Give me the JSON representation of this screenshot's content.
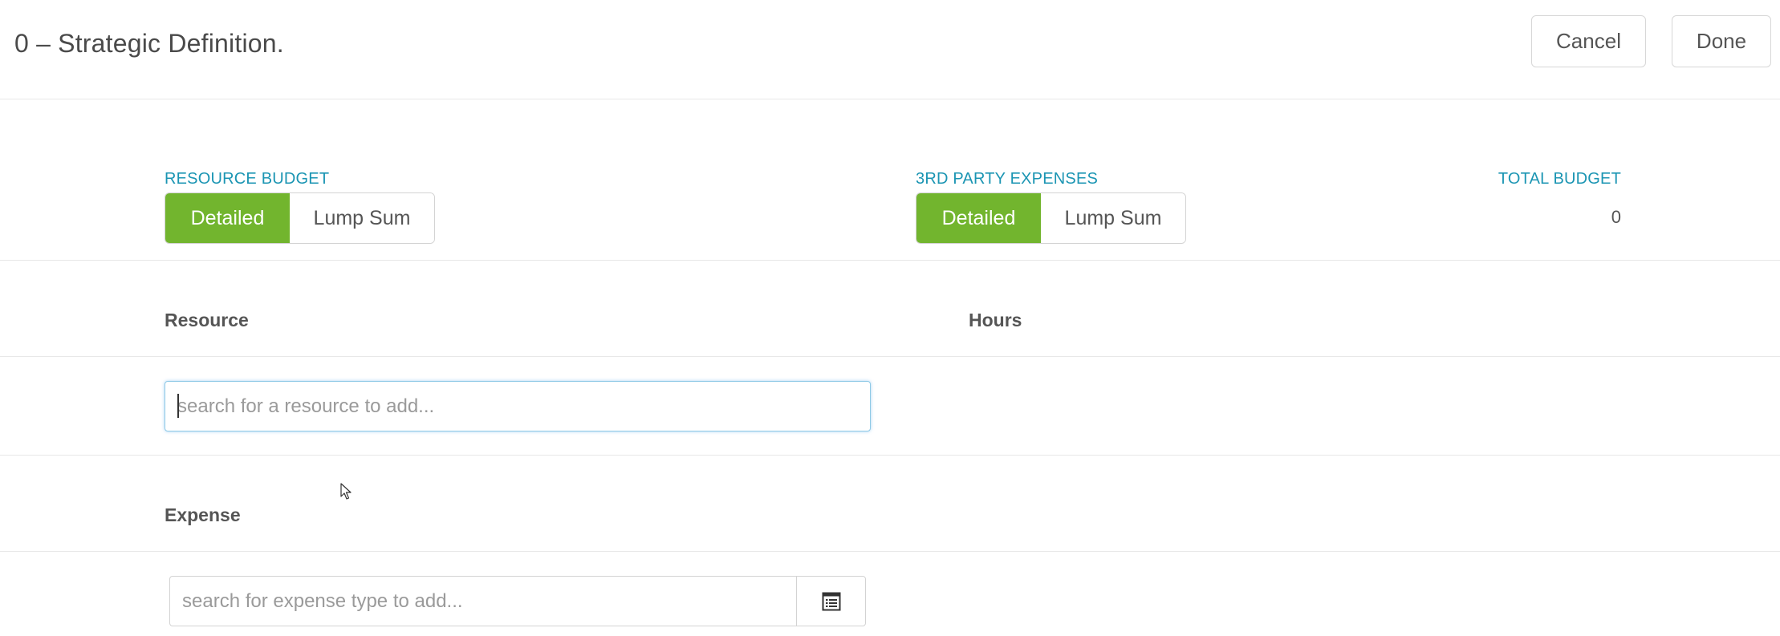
{
  "header": {
    "title": "0 – Strategic Definition.",
    "cancel_label": "Cancel",
    "done_label": "Done"
  },
  "resource_budget": {
    "label": "RESOURCE BUDGET",
    "options": [
      "Detailed",
      "Lump Sum"
    ],
    "selected": "Detailed"
  },
  "third_party_expenses": {
    "label": "3RD PARTY EXPENSES",
    "options": [
      "Detailed",
      "Lump Sum"
    ],
    "selected": "Detailed"
  },
  "total_budget": {
    "label": "TOTAL BUDGET",
    "value": "0"
  },
  "resources": {
    "col_resource": "Resource",
    "col_hours": "Hours",
    "search_value": "",
    "search_placeholder": "search for a resource to add..."
  },
  "expenses": {
    "col_expense": "Expense",
    "search_value": "",
    "search_placeholder": "search for expense type to add...",
    "list_icon": "list-icon"
  },
  "colors": {
    "accent_green": "#72b52e",
    "label_blue": "#1b95b3",
    "focus_blue": "#8ec9e6"
  }
}
